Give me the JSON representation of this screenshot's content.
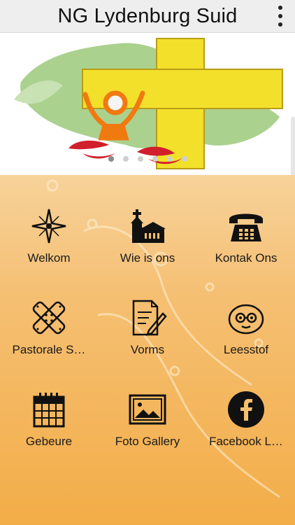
{
  "app": {
    "title": "NG Lydenburg Suid"
  },
  "menu": {
    "icon": "overflow-menu-icon"
  },
  "banner": {
    "slides": 6,
    "active_slide": 0
  },
  "tiles": [
    {
      "label": "Welkom",
      "icon": "star-icon"
    },
    {
      "label": "Wie is ons",
      "icon": "church-icon"
    },
    {
      "label": "Kontak Ons",
      "icon": "telephone-icon"
    },
    {
      "label": "Pastorale S…",
      "icon": "bandage-icon"
    },
    {
      "label": "Vorms",
      "icon": "form-edit-icon"
    },
    {
      "label": "Leesstof",
      "icon": "reading-face-icon"
    },
    {
      "label": "Gebeure",
      "icon": "calendar-icon"
    },
    {
      "label": "Foto Gallery",
      "icon": "photo-gallery-icon"
    },
    {
      "label": "Facebook L…",
      "icon": "facebook-icon"
    }
  ]
}
